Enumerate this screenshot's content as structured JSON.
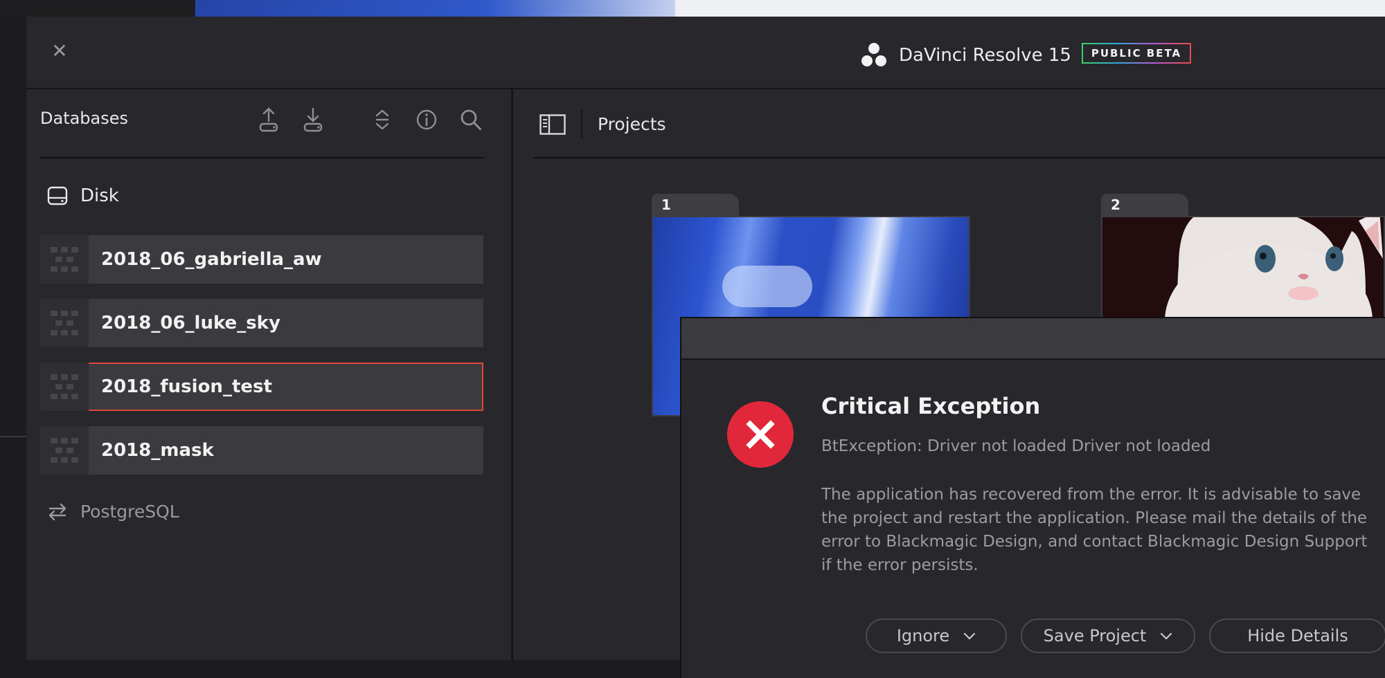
{
  "app": {
    "title": "DaVinci Resolve 15",
    "badge": "PUBLIC BETA",
    "close_icon": "close-icon"
  },
  "databases": {
    "header": "Databases",
    "tools": [
      "upload-icon",
      "download-icon",
      "sort-icon",
      "info-icon",
      "search-icon"
    ],
    "group_label": "Disk",
    "items": [
      {
        "name": "2018_06_gabriella_aw",
        "selected": false
      },
      {
        "name": "2018_06_luke_sky",
        "selected": false
      },
      {
        "name": "2018_fusion_test",
        "selected": true
      },
      {
        "name": "2018_mask",
        "selected": false
      }
    ],
    "network_label": "PostgreSQL",
    "selection_color": "#e0463a"
  },
  "projects": {
    "title": "Projects",
    "cards": [
      {
        "number": "1"
      },
      {
        "number": "2"
      }
    ]
  },
  "dialog": {
    "title": "Critical Exception",
    "exception": "BtException: Driver not loaded Driver not loaded",
    "body": "The application has recovered from the error. It is advisable to save the project and restart the application. Please mail the details of the error to Blackmagic Design, and contact Blackmagic Design Support if the error persists.",
    "icon": "error-icon",
    "icon_color": "#e0283a",
    "buttons": {
      "ignore": "Ignore",
      "save_project": "Save Project",
      "hide_details": "Hide Details"
    }
  }
}
